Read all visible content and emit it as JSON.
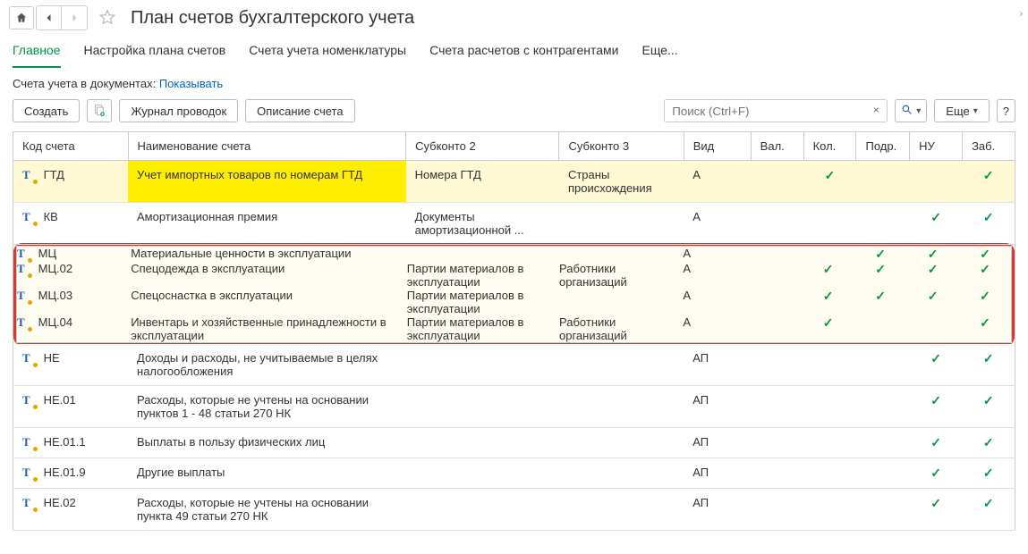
{
  "header": {
    "title": "План счетов бухгалтерского учета"
  },
  "tabs": [
    {
      "label": "Главное",
      "active": true
    },
    {
      "label": "Настройка плана счетов",
      "active": false
    },
    {
      "label": "Счета учета номенклатуры",
      "active": false
    },
    {
      "label": "Счета расчетов с контрагентами",
      "active": false
    },
    {
      "label": "Еще...",
      "active": false
    }
  ],
  "info": {
    "prefix": "Счета учета в документах: ",
    "link": "Показывать"
  },
  "toolbar": {
    "create": "Создать",
    "journal": "Журнал проводок",
    "desc": "Описание счета",
    "more": "Еще",
    "search_placeholder": "Поиск (Ctrl+F)"
  },
  "columns": {
    "code": "Код счета",
    "name": "Наименование счета",
    "sub2": "Субконто 2",
    "sub3": "Субконто 3",
    "vid": "Вид",
    "val": "Вал.",
    "kol": "Кол.",
    "podr": "Подр.",
    "nu": "НУ",
    "zab": "Заб."
  },
  "rows": [
    {
      "code": "ГТД",
      "name": "Учет импортных товаров по номерам ГТД",
      "sub2": "Номера ГТД",
      "sub3": "Страны происхождения",
      "vid": "А",
      "val": false,
      "kol": true,
      "podr": false,
      "nu": false,
      "zab": true,
      "style": "highlight-yellow",
      "framed": false
    },
    {
      "code": "КВ",
      "name": "Амортизационная премия",
      "sub2": "Документы амортизационной ...",
      "sub3": "",
      "vid": "А",
      "val": false,
      "kol": false,
      "podr": false,
      "nu": true,
      "zab": true,
      "style": "plain",
      "framed": false
    },
    {
      "code": "МЦ",
      "name": "Материальные ценности в эксплуатации",
      "sub2": "",
      "sub3": "",
      "vid": "А",
      "val": false,
      "kol": false,
      "podr": true,
      "nu": true,
      "zab": true,
      "style": "soft",
      "framed": true
    },
    {
      "code": "МЦ.02",
      "name": "Спецодежда в эксплуатации",
      "sub2": "Партии материалов в эксплуатации",
      "sub3": "Работники организаций",
      "vid": "А",
      "val": false,
      "kol": true,
      "podr": true,
      "nu": true,
      "zab": true,
      "style": "soft",
      "framed": true
    },
    {
      "code": "МЦ.03",
      "name": "Спецоснастка в эксплуатации",
      "sub2": "Партии материалов в эксплуатации",
      "sub3": "",
      "vid": "А",
      "val": false,
      "kol": true,
      "podr": true,
      "nu": true,
      "zab": true,
      "style": "soft",
      "framed": true
    },
    {
      "code": "МЦ.04",
      "name": "Инвентарь и хозяйственные принадлежности в эксплуатации",
      "sub2": "Партии материалов в эксплуатации",
      "sub3": "Работники организаций",
      "vid": "А",
      "val": false,
      "kol": true,
      "podr": false,
      "nu": false,
      "zab": true,
      "style": "soft",
      "framed": true
    },
    {
      "code": "НЕ",
      "name": "Доходы и расходы, не учитываемые в целях налогообложения",
      "sub2": "",
      "sub3": "",
      "vid": "АП",
      "val": false,
      "kol": false,
      "podr": false,
      "nu": true,
      "zab": true,
      "style": "plain",
      "framed": false
    },
    {
      "code": "НЕ.01",
      "name": "Расходы, которые не учтены на основании пунктов 1 - 48 статьи 270 НК",
      "sub2": "",
      "sub3": "",
      "vid": "АП",
      "val": false,
      "kol": false,
      "podr": false,
      "nu": true,
      "zab": true,
      "style": "plain",
      "framed": false
    },
    {
      "code": "НЕ.01.1",
      "name": "Выплаты в пользу физических лиц",
      "sub2": "",
      "sub3": "",
      "vid": "АП",
      "val": false,
      "kol": false,
      "podr": false,
      "nu": true,
      "zab": true,
      "style": "plain",
      "framed": false
    },
    {
      "code": "НЕ.01.9",
      "name": "Другие выплаты",
      "sub2": "",
      "sub3": "",
      "vid": "АП",
      "val": false,
      "kol": false,
      "podr": false,
      "nu": true,
      "zab": true,
      "style": "plain",
      "framed": false
    },
    {
      "code": "НЕ.02",
      "name": "Расходы, которые не учтены на основании пункта 49 статьи 270 НК",
      "sub2": "",
      "sub3": "",
      "vid": "АП",
      "val": false,
      "kol": false,
      "podr": false,
      "nu": true,
      "zab": true,
      "style": "plain",
      "framed": false
    }
  ]
}
